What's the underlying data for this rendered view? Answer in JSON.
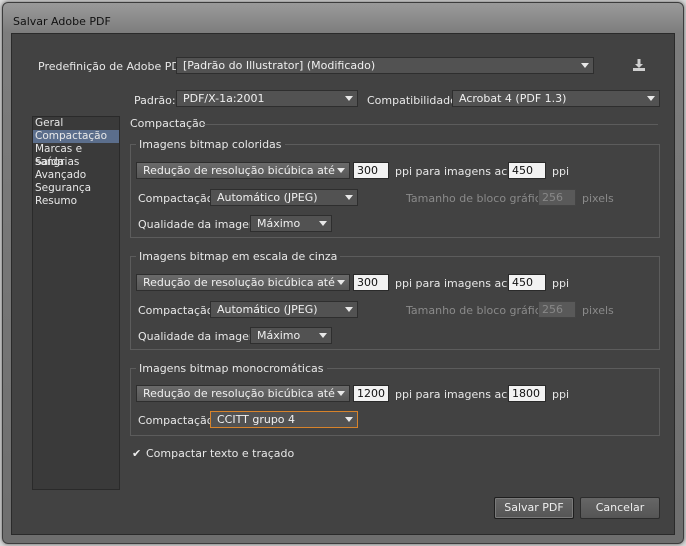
{
  "window": {
    "title": "Salvar Adobe PDF"
  },
  "preset": {
    "label": "Predefinição de Adobe PDF:",
    "value": "[Padrão do Illustrator] (Modificado)"
  },
  "standard": {
    "label": "Padrão:",
    "value": "PDF/X-1a:2001"
  },
  "compatibility": {
    "label": "Compatibilidade:",
    "value": "Acrobat 4 (PDF 1.3)"
  },
  "sidebar": {
    "items": [
      {
        "label": "Geral",
        "selected": false
      },
      {
        "label": "Compactação",
        "selected": true
      },
      {
        "label": "Marcas e sangrias",
        "selected": false
      },
      {
        "label": "Saída",
        "selected": false
      },
      {
        "label": "Avançado",
        "selected": false
      },
      {
        "label": "Segurança",
        "selected": false
      },
      {
        "label": "Resumo",
        "selected": false
      }
    ]
  },
  "section_title": "Compactação",
  "color": {
    "title": "Imagens bitmap coloridas",
    "resample_method": "Redução de resolução bicúbica até",
    "resample_ppi": "300",
    "above_label": "ppi para imagens acima",
    "above_ppi": "450",
    "ppi_unit": "ppi",
    "compression_label": "Compactação:",
    "compression_value": "Automático (JPEG)",
    "tile_label": "Tamanho de bloco gráfico:",
    "tile_value": "256",
    "tile_unit": "pixels",
    "quality_label": "Qualidade da imagem:",
    "quality_value": "Máximo"
  },
  "gray": {
    "title": "Imagens bitmap em escala de cinza",
    "resample_method": "Redução de resolução bicúbica até",
    "resample_ppi": "300",
    "above_label": "ppi para imagens acima",
    "above_ppi": "450",
    "ppi_unit": "ppi",
    "compression_label": "Compactação:",
    "compression_value": "Automático (JPEG)",
    "tile_label": "Tamanho de bloco gráfico:",
    "tile_value": "256",
    "tile_unit": "pixels",
    "quality_label": "Qualidade da imagem:",
    "quality_value": "Máximo"
  },
  "mono": {
    "title": "Imagens bitmap monocromáticas",
    "resample_method": "Redução de resolução bicúbica até",
    "resample_ppi": "1200",
    "above_label": "ppi para imagens acima",
    "above_ppi": "1800",
    "ppi_unit": "ppi",
    "compression_label": "Compactação:",
    "compression_value": "CCITT grupo 4"
  },
  "compress_text": {
    "label": "Compactar texto e traçado",
    "checked": true
  },
  "buttons": {
    "save": "Salvar PDF",
    "cancel": "Cancelar"
  }
}
